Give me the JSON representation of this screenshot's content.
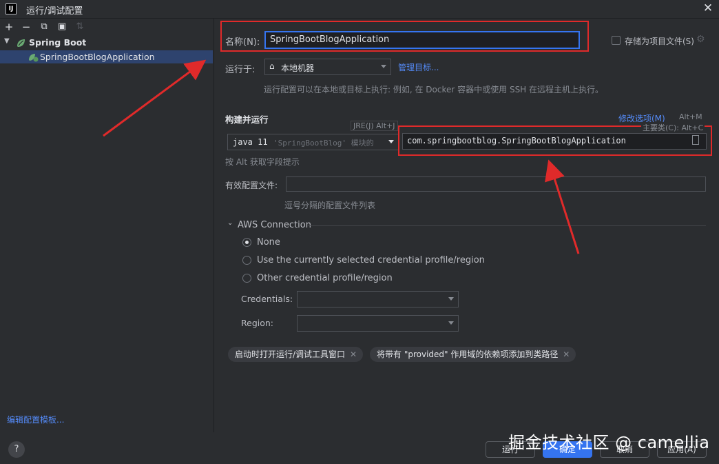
{
  "window": {
    "logo_text": "IJ",
    "title": "运行/调试配置"
  },
  "toolbar": {
    "icons": [
      "add-icon",
      "remove-icon",
      "copy-icon",
      "new-folder-icon",
      "sort-icon"
    ],
    "glyphs": [
      "+",
      "−",
      "⧉",
      "▣",
      "⇅"
    ]
  },
  "tree": {
    "root_label": "Spring Boot",
    "child_label": "SpringBootBlogApplication"
  },
  "edit_templates_link": "编辑配置模板...",
  "help": "?",
  "name_field": {
    "label": "名称(N):",
    "value": "SpringBootBlogApplication"
  },
  "store_as_file": {
    "label": "存储为项目文件(S)",
    "checked": false
  },
  "run_on": {
    "label": "运行于:",
    "value": "本地机器",
    "manage_link": "管理目标...",
    "hint": "运行配置可以在本地或目标上执行: 例如, 在 Docker 容器中或使用 SSH 在远程主机上执行。"
  },
  "build_run": {
    "section_label": "构建并运行",
    "modify_options": "修改选项(M)",
    "modify_shortcut": "Alt+M",
    "jre_tooltip": "JRE(J) Alt+J",
    "jre_value": "java 11",
    "jre_suffix": "'SpringBootBlog' 模块的",
    "main_class_tooltip": "主要类(C): Alt+C",
    "main_class": "com.springbootblog.SpringBootBlogApplication",
    "alt_hint": "按 Alt 获取字段提示"
  },
  "profiles": {
    "label": "有效配置文件:",
    "value": "",
    "hint": "逗号分隔的配置文件列表"
  },
  "aws": {
    "section_label": "AWS Connection",
    "options": [
      "None",
      "Use the currently selected credential profile/region",
      "Other credential profile/region"
    ],
    "selected": "None",
    "credentials_label": "Credentials:",
    "region_label": "Region:"
  },
  "chips": [
    "启动时打开运行/调试工具窗口",
    "将带有 \"provided\" 作用域的依赖项添加到类路径"
  ],
  "buttons": {
    "run": "运行",
    "ok": "确定",
    "cancel": "取消",
    "apply": "应用(A)"
  },
  "watermark": "掘金技术社区 @ camellia",
  "colors": {
    "background": "#2b2d30",
    "accent": "#3574f0",
    "link": "#548af7",
    "selection": "#2e436e",
    "annotation": "#e02a2a"
  }
}
